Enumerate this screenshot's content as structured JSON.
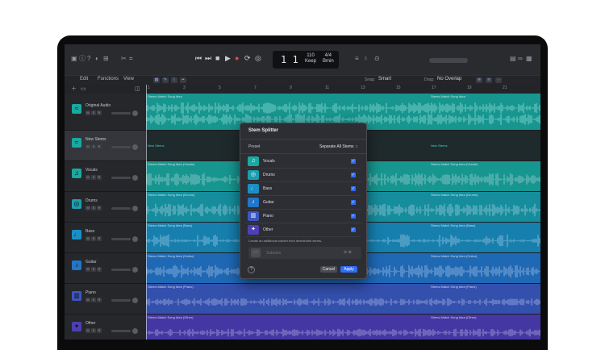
{
  "transport": {
    "position": "1  1",
    "bpm": "110",
    "bpm_label": "Keep",
    "sig": "4/4",
    "key": "Bmin"
  },
  "toolbar": {
    "menus": [
      "Edit",
      "Functions",
      "View"
    ],
    "snap_label": "Snap:",
    "snap_value": "Smart",
    "drag_label": "Drag:",
    "drag_value": "No Overlap"
  },
  "ruler": [
    "1",
    "3",
    "5",
    "7",
    "9",
    "11",
    "13",
    "15",
    "17",
    "19",
    "21"
  ],
  "tracks": [
    {
      "name": "Original Audio",
      "icon": "waveform-icon",
      "color": "#19a9a1"
    },
    {
      "name": "New Stems",
      "icon": "waveform-icon",
      "color": "#19a9a1"
    },
    {
      "name": "Vocals",
      "icon": "mic-icon",
      "color": "#19a9a1"
    },
    {
      "name": "Drums",
      "icon": "drums-icon",
      "color": "#1b9fb0"
    },
    {
      "name": "Bass",
      "icon": "bass-icon",
      "color": "#1b8fc4"
    },
    {
      "name": "Guitar",
      "icon": "guitar-icon",
      "color": "#2276c9"
    },
    {
      "name": "Piano",
      "icon": "piano-icon",
      "color": "#3d56c1"
    },
    {
      "name": "Other",
      "icon": "sparkle-icon",
      "color": "#4d3fb6"
    }
  ],
  "regions": {
    "original": "Stems Match Song Idea",
    "new_stems": "New Stems",
    "vocals": "Stems Match Song Idea (Vocals)",
    "drums": "Stems Match Song Idea (Drums)",
    "bass": "Stems Match Song Idea (Bass)",
    "guitar": "Stems Match Song Idea (Guitar)",
    "piano": "Stems Match Song Idea (Piano)",
    "other": "Stems Match Song Idea (Other)"
  },
  "dialog": {
    "title": "Stem Splitter",
    "preset_label": "Preset",
    "preset_value": "Separate All Stems",
    "stems": [
      {
        "name": "Vocals",
        "icon": "mic-icon",
        "color": "#19a9a1"
      },
      {
        "name": "Drums",
        "icon": "drums-icon",
        "color": "#1b9fb0"
      },
      {
        "name": "Bass",
        "icon": "bass-icon",
        "color": "#1b8fc4"
      },
      {
        "name": "Guitar",
        "icon": "guitar-icon",
        "color": "#2276c9"
      },
      {
        "name": "Piano",
        "icon": "piano-icon",
        "color": "#3d56c1"
      },
      {
        "name": "Other",
        "icon": "sparkle-icon",
        "color": "#4d3fb6"
      }
    ],
    "description": "Create an additional subset from deselected stems.",
    "extra_placeholder": "Subsets",
    "cancel": "Cancel",
    "apply": "Apply"
  }
}
